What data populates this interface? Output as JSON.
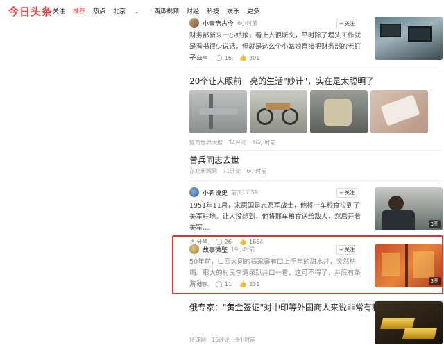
{
  "header": {
    "logo": "今日头条",
    "nav": [
      "关注",
      "推荐",
      "热点",
      "北京",
      "西瓜视频",
      "财经",
      "科技",
      "娱乐",
      "更多"
    ],
    "active_index": 1,
    "dropdown_index": 3
  },
  "items": [
    {
      "author": "小壹盘古今",
      "time": "6小时前",
      "follow": "+ 关注",
      "text": "财务部新来一小姑娘，看上去很斯文，平时除了埋头工作就是看书很少说话。但就是这么个小姑娘直接把财务部的老钉子…",
      "share": "分享",
      "comments": "16",
      "likes": "301"
    },
    {
      "title": "20个让人眼前一亮的生活\"妙计\"，实在是太聪明了",
      "source": "惊奇世界大搜",
      "comments": "34评论",
      "time": "16小时前"
    },
    {
      "title": "曾兵同志去世",
      "source": "东北新闻网",
      "comments": "71评论",
      "time": "6小时前"
    },
    {
      "author": "小靳说史",
      "time": "前天17:59",
      "follow": "+ 关注",
      "text": "1951年11月，宋惠国是志愿军战士，他将一车粮食拉到了美军驻地。让人没想到，他将那车粮食送给敌人，然后开着美军…",
      "share": "分享",
      "comments": "26",
      "likes": "1664",
      "badge": "3图"
    },
    {
      "author": "故事微鉴",
      "time": "19小时前",
      "follow": "+ 关注",
      "text": "50年前，山西大同的石家寨有口上千年的甜水井，突然枯竭。眼大的村民李清泉趴井口一看，这可不得了，井底有条游动…",
      "share": "分享",
      "comments": "11",
      "likes": "231",
      "badge": "3图"
    },
    {
      "title": "俄专家：\"黄金签证\"对中印等外国商人来说非常有利",
      "source": "环球网",
      "comments": "16评论",
      "time": "9小时前"
    }
  ],
  "colors": {
    "brand": "#f04142",
    "highlight": "#e5322d"
  }
}
